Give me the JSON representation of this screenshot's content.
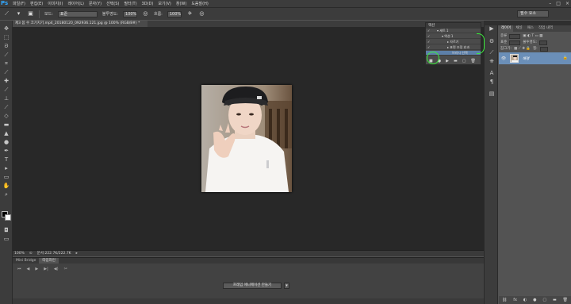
{
  "app": {
    "logo": "Ps"
  },
  "menu": [
    "파일(F)",
    "편집(E)",
    "이미지(I)",
    "레이어(L)",
    "문자(Y)",
    "선택(S)",
    "필터(T)",
    "3D(D)",
    "보기(V)",
    "창(W)",
    "도움말(H)"
  ],
  "window_controls": [
    "–",
    "□",
    "×"
  ],
  "options": {
    "mode_label": "모드:",
    "mode_value": "표준",
    "opacity_label": "불투명도:",
    "opacity_value": "100%",
    "flow_label": "흐름:",
    "flow_value": "100%",
    "workspace": "필수 요소"
  },
  "document": {
    "tab_title": "제3 몸 수 크기지기.mp4_20180120_092936.121.jpg @ 100% (RGB/8#) *"
  },
  "status": {
    "zoom": "100%",
    "doc_size": "문서:222.7K/222.7K"
  },
  "timeline": {
    "tabs": [
      "Mini Bridge",
      "타임라인"
    ],
    "controls": [
      "⏮",
      "◀",
      "▶",
      "▶|",
      "◀)",
      "✂"
    ],
    "create_button": "프레임 애니메이션 만들기",
    "dropdown_arrow": "▾"
  },
  "actions_panel": {
    "title": "액션",
    "rows": [
      {
        "check": "✓",
        "label": "▾ 세트 1"
      },
      {
        "check": "✓",
        "label": "▾ 액션 1"
      },
      {
        "check": "✓",
        "label": "▸ 자르기"
      },
      {
        "check": "✓",
        "label": "▸ 표면 조정 효과"
      },
      {
        "check": "",
        "label": "브러시 선택"
      }
    ],
    "footer_icons": [
      "■",
      "●",
      "▶",
      "▬",
      "▢",
      "🗑"
    ]
  },
  "layers_panel": {
    "tabs": [
      "레이어",
      "채널",
      "패스",
      "작업 내역"
    ],
    "filter_label": "종류",
    "blend_mode": "표준",
    "opacity_label": "불투명도:",
    "lock_label": "잠그기:",
    "fill_label": "칠:",
    "layer_name": "배경",
    "lock_icon": "🔒",
    "footer_icons": [
      "⛓",
      "fx",
      "◐",
      "●",
      "▢",
      "▬",
      "🗑"
    ]
  },
  "colors": {
    "accent_highlight": "#3cf03c",
    "selected_row": "#5d7fa8",
    "layer_selected": "#6b8fb8",
    "ps_blue": "#31a8ff"
  }
}
